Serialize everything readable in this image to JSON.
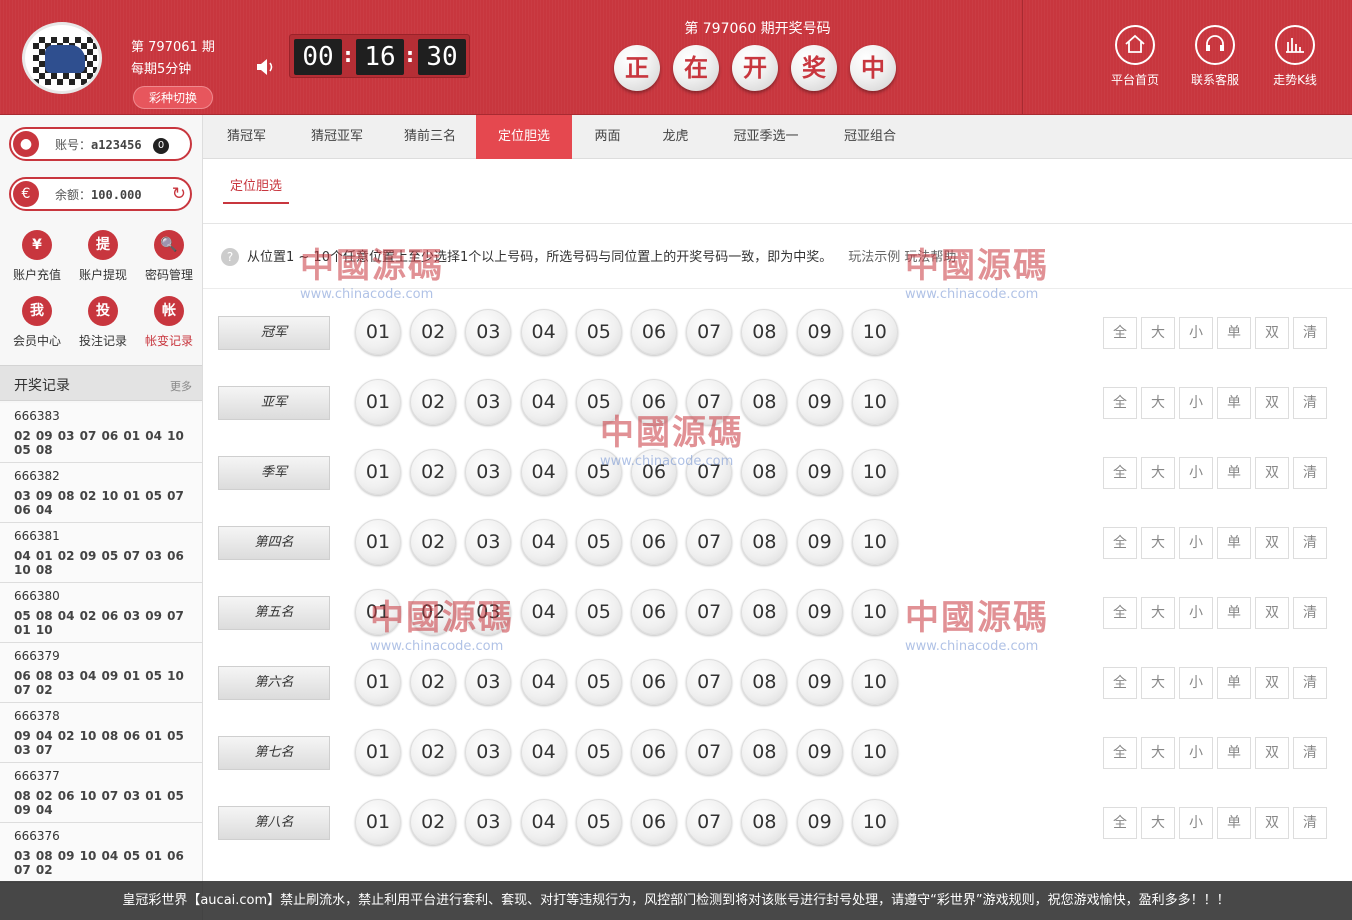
{
  "header": {
    "current_issue": "第 797061 期",
    "interval": "每期5分钟",
    "switch_label": "彩种切换",
    "timer": {
      "h": "00",
      "m": "16",
      "s": "30",
      "sep": ":"
    },
    "draw_title": "第 797060 期开奖号码",
    "drawing_chars": [
      "正",
      "在",
      "开",
      "奖",
      "中"
    ],
    "nav": [
      {
        "label": "平台首页",
        "icon": "home-icon"
      },
      {
        "label": "联系客服",
        "icon": "headset-icon"
      },
      {
        "label": "走势K线",
        "icon": "chart-icon"
      }
    ]
  },
  "sidebar": {
    "account_label": "账号：",
    "account_value": "a123456",
    "account_badge": "0",
    "balance_label": "余额：",
    "balance_value": "100.000",
    "quick": [
      {
        "label": "账户充值",
        "glyph": "¥"
      },
      {
        "label": "账户提现",
        "glyph": "提"
      },
      {
        "label": "密码管理",
        "glyph": "🔍"
      },
      {
        "label": "会员中心",
        "glyph": "我"
      },
      {
        "label": "投注记录",
        "glyph": "投"
      },
      {
        "label": "帐变记录",
        "glyph": "帐"
      }
    ],
    "records_title": "开奖记录",
    "records_more": "更多",
    "records": [
      {
        "id": "666383",
        "nums": "02 09 03 07 06 01 04 10 05 08"
      },
      {
        "id": "666382",
        "nums": "03 09 08 02 10 01 05 07 06 04"
      },
      {
        "id": "666381",
        "nums": "04 01 02 09 05 07 03 06 10 08"
      },
      {
        "id": "666380",
        "nums": "05 08 04 02 06 03 09 07 01 10"
      },
      {
        "id": "666379",
        "nums": "06 08 03 04 09 01 05 10 07 02"
      },
      {
        "id": "666378",
        "nums": "09 04 02 10 08 06 01 05 03 07"
      },
      {
        "id": "666377",
        "nums": "08 02 06 10 07 03 01 05 09 04"
      },
      {
        "id": "666376",
        "nums": "03 08 09 10 04 05 01 06 07 02"
      }
    ]
  },
  "tabs": [
    "猜冠军",
    "猜冠亚军",
    "猜前三名",
    "定位胆选",
    "两面",
    "龙虎",
    "冠亚季选一",
    "冠亚组合"
  ],
  "active_tab": "定位胆选",
  "subtab": "定位胆选",
  "rule_text": "从位置1 ~ 10个任意位置上至少选择1个以上号码，所选号码与同位置上的开奖号码一致，即为中奖。",
  "rule_links": "玩法示例   玩法帮助",
  "positions": [
    "冠军",
    "亚军",
    "季军",
    "第四名",
    "第五名",
    "第六名",
    "第七名",
    "第八名"
  ],
  "numbers": [
    "01",
    "02",
    "03",
    "04",
    "05",
    "06",
    "07",
    "08",
    "09",
    "10"
  ],
  "quick_select": [
    "全",
    "大",
    "小",
    "单",
    "双",
    "清"
  ],
  "footer_text": "皇冠彩世界【aucai.com】禁止刷流水，禁止利用平台进行套利、套现、对打等违规行为，风控部门检测到将对该账号进行封号处理，请遵守“彩世界”游戏规则，祝您游戏愉快，盈利多多！！！",
  "watermark": {
    "title": "中國源碼",
    "url": "www.chinacode.com"
  },
  "colors": {
    "brand": "#c8363e",
    "active_tab": "#e5484f"
  }
}
